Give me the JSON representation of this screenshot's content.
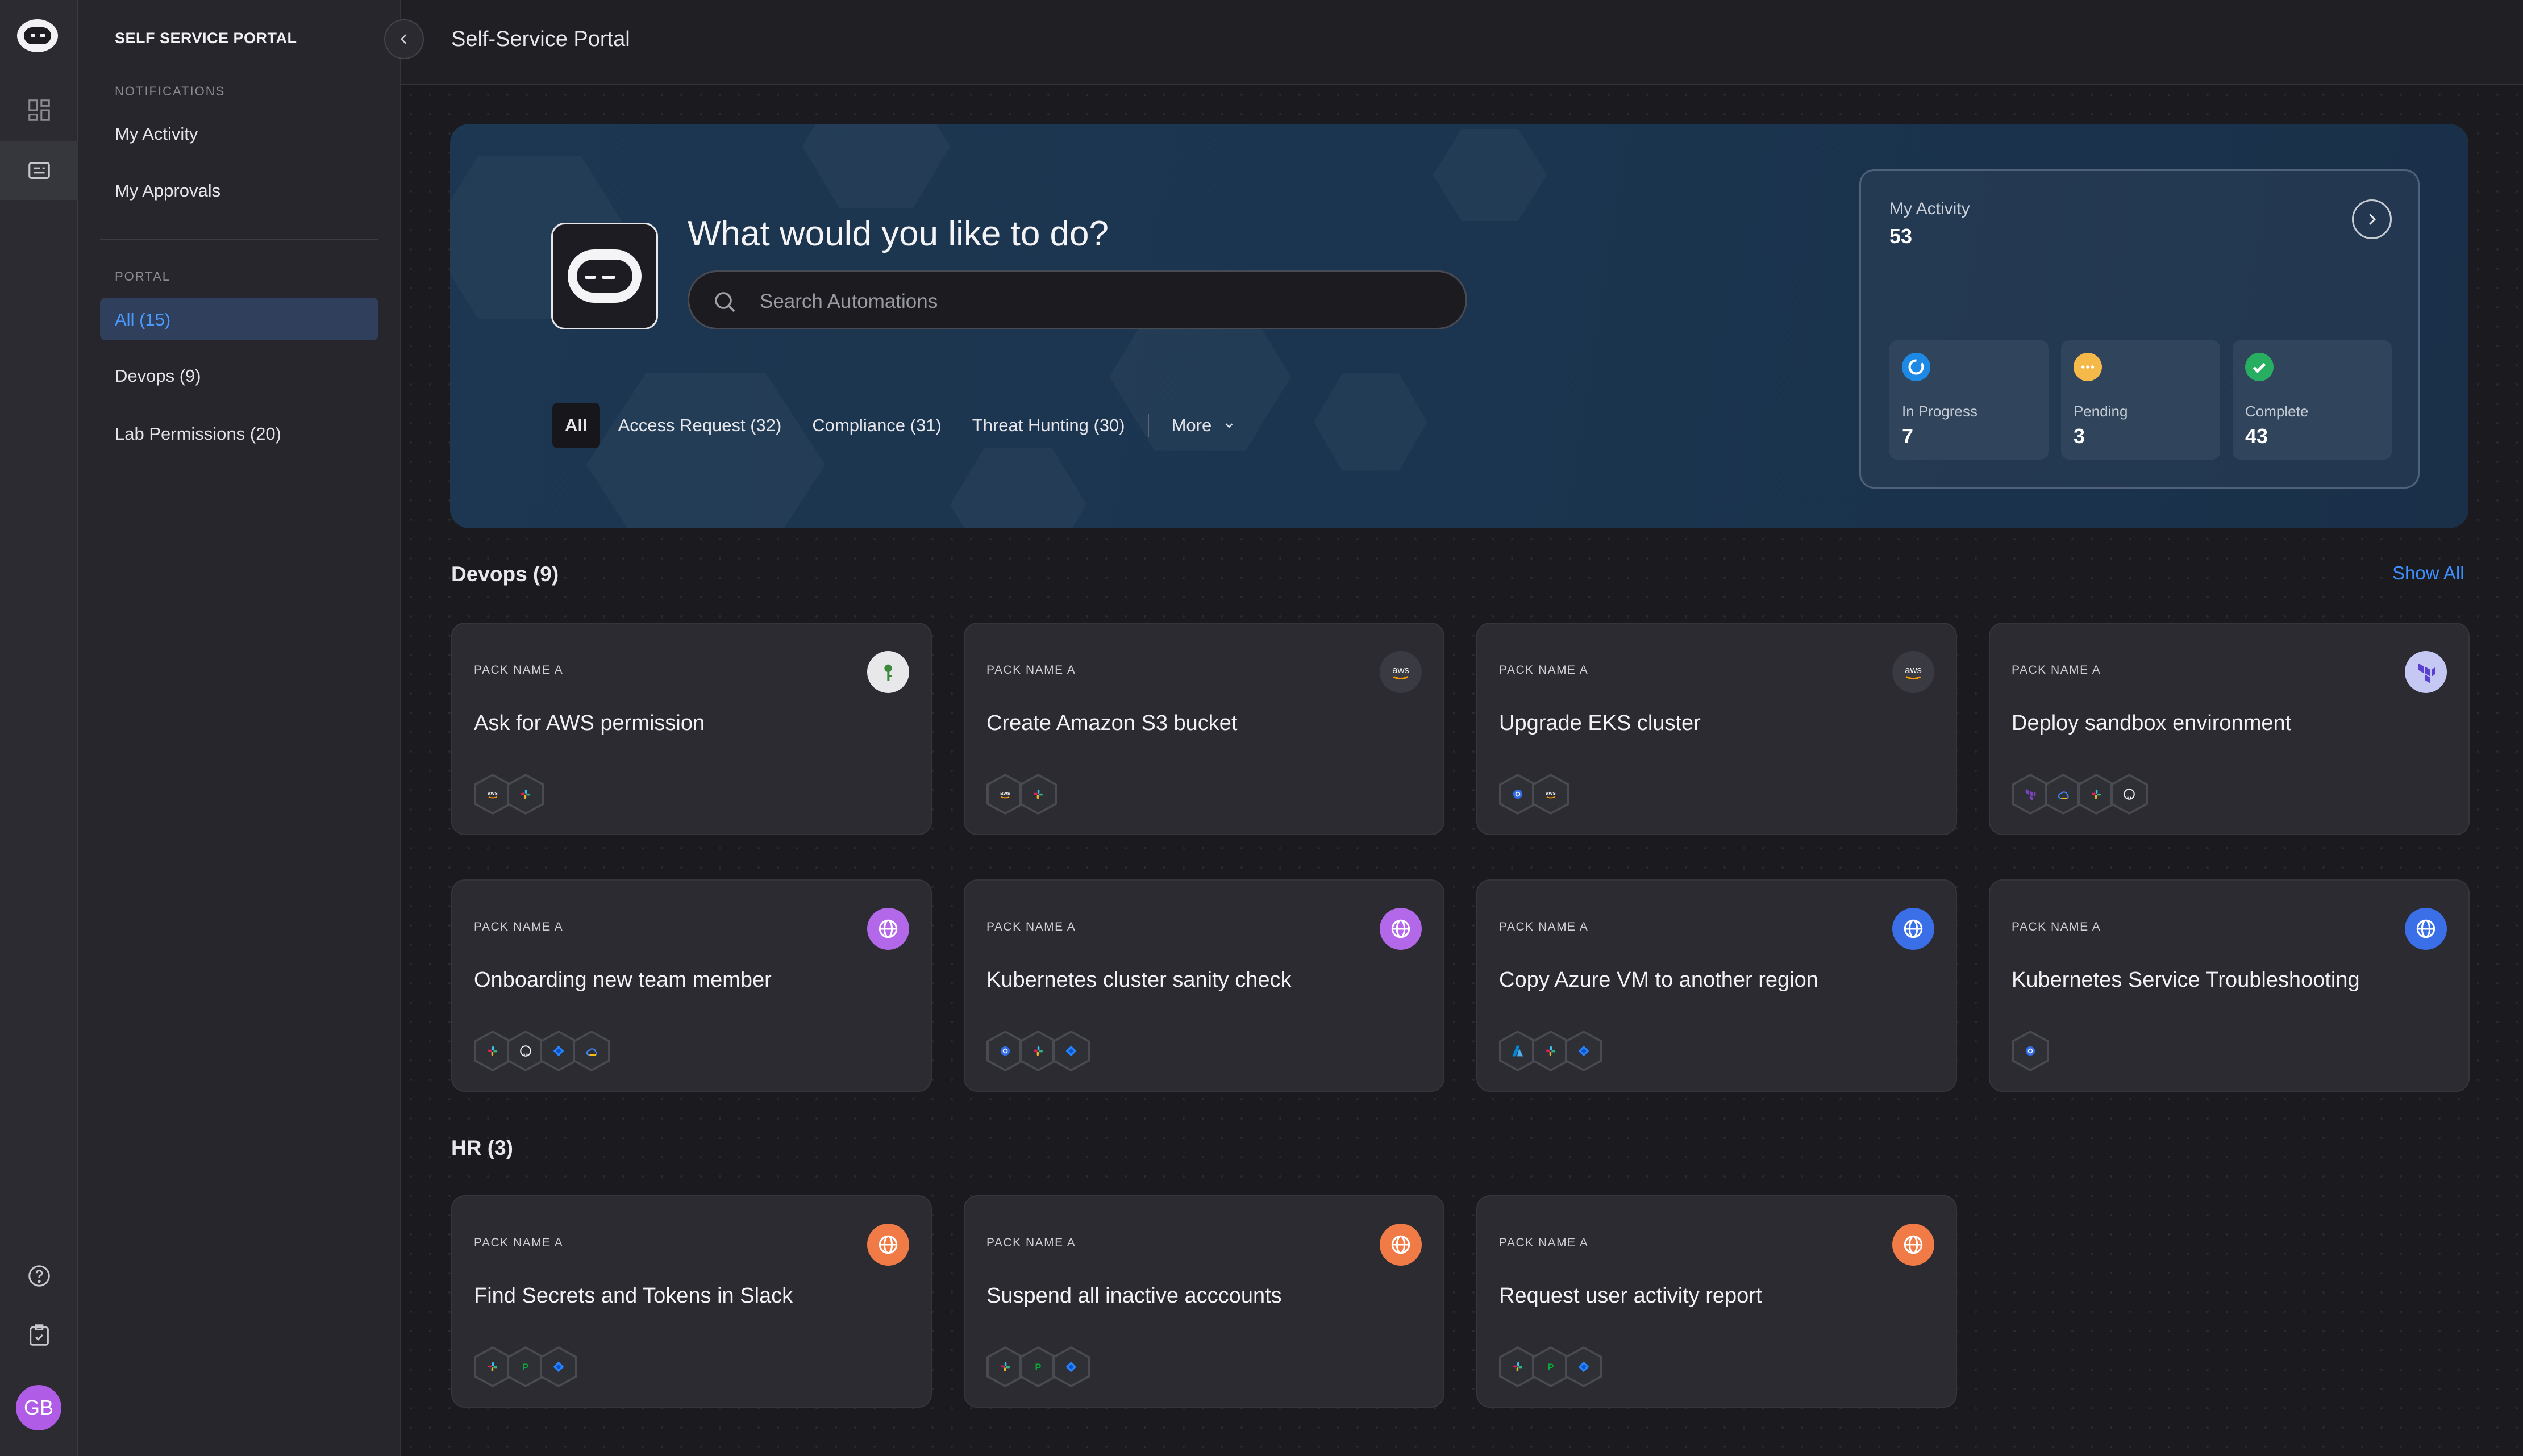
{
  "sidebar": {
    "title": "SELF SERVICE PORTAL",
    "notifications_label": "NOTIFICATIONS",
    "my_activity": "My Activity",
    "my_approvals": "My Approvals",
    "portal_label": "PORTAL",
    "items": [
      {
        "label": "All (15)",
        "selected": true
      },
      {
        "label": "Devops (9)",
        "selected": false
      },
      {
        "label": "Lab Permissions (20)",
        "selected": false
      }
    ]
  },
  "rail": {
    "icons": [
      "logo-icon",
      "dashboard-icon",
      "portal-icon",
      "help-icon",
      "clipboard-check-icon"
    ],
    "avatar_initials": "GB",
    "avatar_color": "#b05ce6"
  },
  "header": {
    "title": "Self-Service Portal"
  },
  "hero": {
    "question": "What would you like to do?",
    "search_placeholder": "Search Automations",
    "filters": [
      {
        "label": "All",
        "active": true
      },
      {
        "label": "Access Request (32)"
      },
      {
        "label": "Compliance (31)"
      },
      {
        "label": "Threat Hunting (30)"
      }
    ],
    "more_label": "More"
  },
  "activity": {
    "label": "My Activity",
    "total": "53",
    "stats": [
      {
        "label": "In Progress",
        "value": "7",
        "color": "#1e88e5"
      },
      {
        "label": "Pending",
        "value": "3",
        "color": "#f5b94a"
      },
      {
        "label": "Complete",
        "value": "43",
        "color": "#27ae60"
      }
    ]
  },
  "sections": {
    "devops": {
      "title": "Devops (9)",
      "show_all": "Show All"
    },
    "hr": {
      "title": "HR (3)"
    }
  },
  "cards": [
    {
      "pack": "PACK NAME A",
      "title": "Ask for AWS permission",
      "icon": "key-icon",
      "icon_bg": "#e8e8ea",
      "integrations": [
        "aws-icon",
        "slack-icon"
      ]
    },
    {
      "pack": "PACK NAME A",
      "title": "Create Amazon S3 bucket",
      "icon": "aws-icon",
      "icon_bg": "#3a3a42",
      "integrations": [
        "aws-icon",
        "slack-icon"
      ]
    },
    {
      "pack": "PACK NAME A",
      "title": "Upgrade EKS cluster",
      "icon": "aws-icon",
      "icon_bg": "#3a3a42",
      "integrations": [
        "kubernetes-icon",
        "aws-icon"
      ]
    },
    {
      "pack": "PACK NAME A",
      "title": "Deploy sandbox environment",
      "icon": "terraform-icon",
      "icon_bg": "#c4c8f2",
      "integrations": [
        "terraform-icon",
        "gcp-icon",
        "slack-icon",
        "github-icon"
      ]
    },
    {
      "pack": "PACK NAME A",
      "title": "Onboarding new team member",
      "icon": "globe-icon",
      "icon_bg": "#b268e8",
      "integrations": [
        "slack-icon",
        "github-icon",
        "jira-icon",
        "gcp-icon"
      ]
    },
    {
      "pack": "PACK NAME A",
      "title": "Kubernetes cluster sanity check",
      "icon": "globe-icon",
      "icon_bg": "#b268e8",
      "integrations": [
        "kubernetes-icon",
        "slack-icon",
        "jira-icon"
      ]
    },
    {
      "pack": "PACK NAME A",
      "title": "Copy Azure VM to another region",
      "icon": "globe-icon",
      "icon_bg": "#3b6fe8",
      "integrations": [
        "azure-icon",
        "slack-icon",
        "jira-icon"
      ]
    },
    {
      "pack": "PACK NAME A",
      "title": "Kubernetes Service Troubleshooting",
      "icon": "globe-icon",
      "icon_bg": "#3b6fe8",
      "integrations": [
        "kubernetes-icon"
      ]
    },
    {
      "pack": "PACK NAME A",
      "title": "Find Secrets and Tokens in Slack",
      "icon": "globe-icon",
      "icon_bg": "#f07b47",
      "integrations": [
        "slack-icon",
        "pagerduty-icon",
        "jira-icon"
      ]
    },
    {
      "pack": "PACK NAME A",
      "title": "Suspend all inactive acccounts",
      "icon": "globe-icon",
      "icon_bg": "#f07b47",
      "integrations": [
        "slack-icon",
        "pagerduty-icon",
        "jira-icon"
      ]
    },
    {
      "pack": "PACK NAME A",
      "title": "Request user activity report",
      "icon": "globe-icon",
      "icon_bg": "#f07b47",
      "integrations": [
        "slack-icon",
        "pagerduty-icon",
        "jira-icon"
      ]
    }
  ]
}
